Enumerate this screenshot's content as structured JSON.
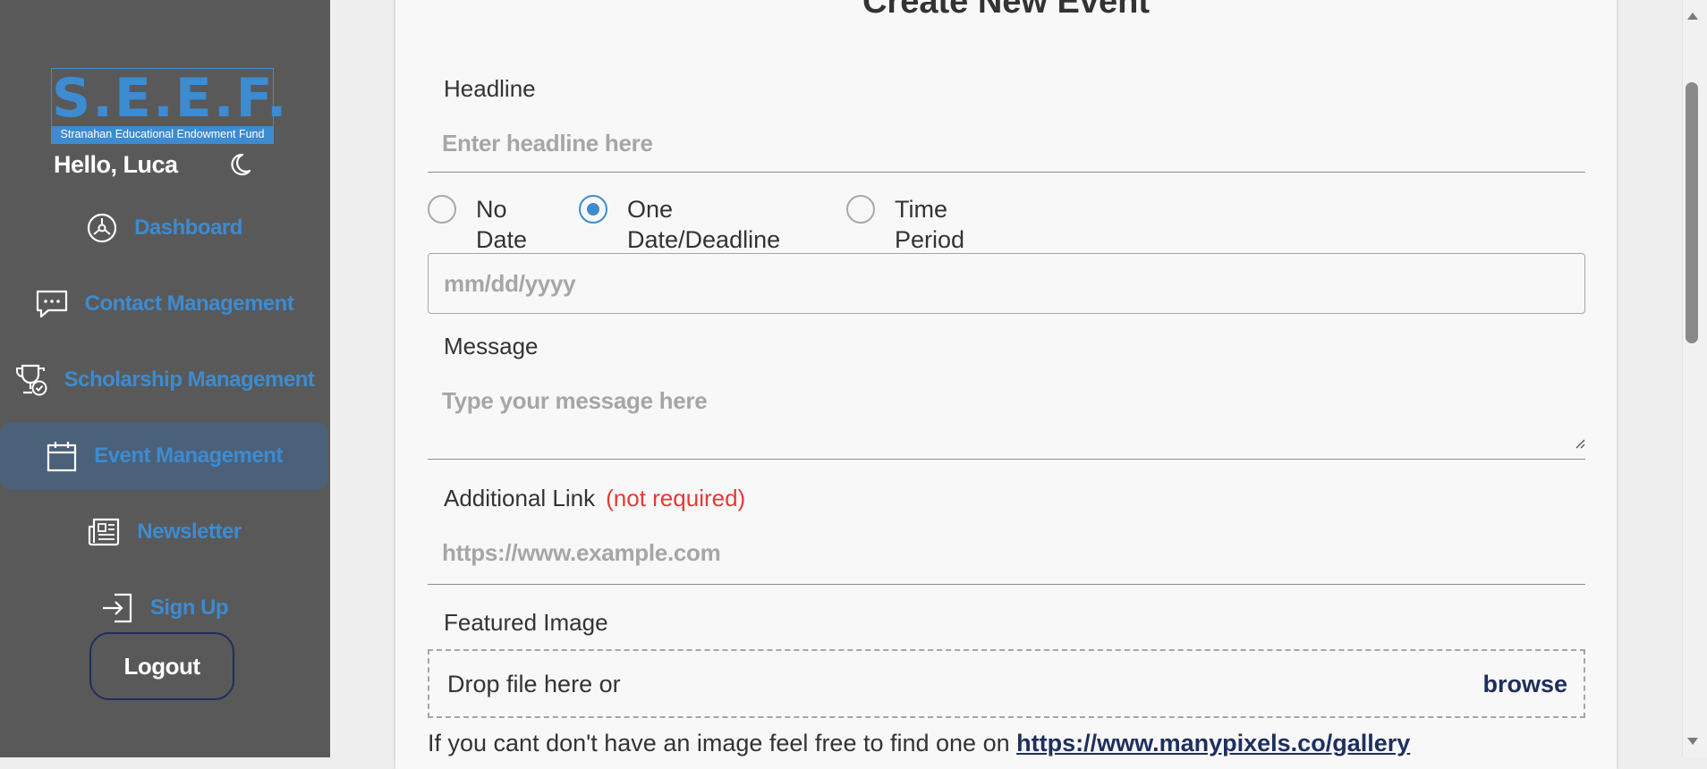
{
  "sidebar": {
    "logo": {
      "main": "S.E.E.F.",
      "sub": "Stranahan Educational Endowment Fund"
    },
    "greeting": "Hello, Luca",
    "theme_icon": "moon-icon",
    "nav": [
      {
        "label": "Dashboard",
        "icon": "dashboard-gauge-icon",
        "active": false
      },
      {
        "label": "Contact Management",
        "icon": "chat-bubble-icon",
        "active": false
      },
      {
        "label": "Scholarship Management",
        "icon": "trophy-check-icon",
        "active": false
      },
      {
        "label": "Event Management",
        "icon": "calendar-icon",
        "active": true
      },
      {
        "label": "Newsletter",
        "icon": "newspaper-icon",
        "active": false
      },
      {
        "label": "Sign Up",
        "icon": "sign-in-icon",
        "active": false
      }
    ],
    "logout_label": "Logout"
  },
  "form": {
    "title": "Create New Event",
    "headline": {
      "label": "Headline",
      "placeholder": "Enter headline here"
    },
    "date_options": [
      {
        "label": "No Date",
        "checked": false
      },
      {
        "label": "One Date/Deadline",
        "checked": true
      },
      {
        "label": "Time Period",
        "checked": false
      }
    ],
    "date_placeholder": "mm/dd/yyyy",
    "message": {
      "label": "Message",
      "placeholder": "Type your message here"
    },
    "link": {
      "label": "Additional Link",
      "note": "(not required)",
      "placeholder": "https://www.example.com"
    },
    "image": {
      "label": "Featured Image",
      "drop_text": "Drop file here or",
      "browse_label": "browse"
    },
    "hint": {
      "text": "If you cant don't have an image feel free to find one on",
      "link": "https://www.manypixels.co/gallery"
    }
  },
  "colors": {
    "sidebar_bg": "#595959",
    "accent": "#3d8bd0",
    "active_bg": "#4b617a",
    "navy": "#1e2f5e",
    "required": "#e53935"
  }
}
